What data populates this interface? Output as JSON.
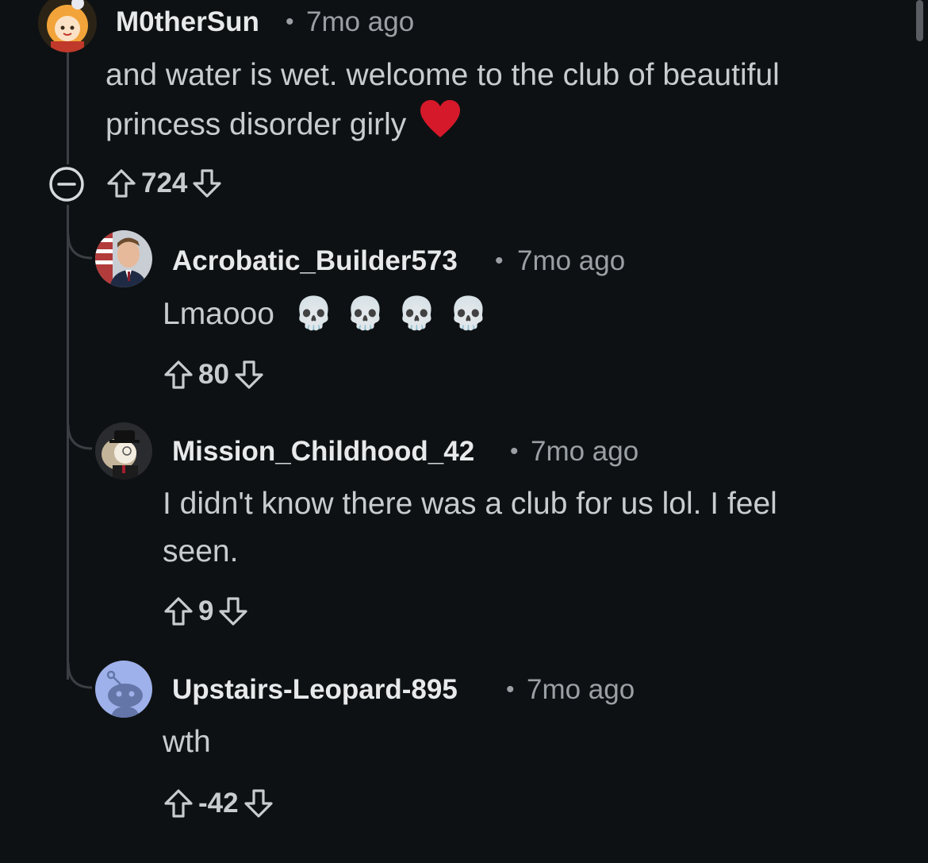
{
  "comments": [
    {
      "username": "M0therSun",
      "separator": "•",
      "time": "7mo ago",
      "body_lines": [
        "and water is wet. welcome to the club of beautiful",
        "princess disorder girly"
      ],
      "emoji": "❤️",
      "score": "724"
    },
    {
      "username": "Acrobatic_Builder573",
      "separator": "•",
      "time": "7mo ago",
      "body": "Lmaooo",
      "emoji": "💀 💀 💀 💀",
      "score": "80"
    },
    {
      "username": "Mission_Childhood_42",
      "separator": "•",
      "time": "7mo ago",
      "body_lines": [
        "I didn't know there was a club for us lol. I feel",
        "seen."
      ],
      "score": "9"
    },
    {
      "username": "Upstairs-Leopard-895",
      "separator": "•",
      "time": "7mo ago",
      "body": "wth",
      "score": "-42"
    }
  ],
  "icons": {
    "collapse": "minus-circle-icon",
    "upvote": "arrow-up-icon",
    "downvote": "arrow-down-icon"
  },
  "colors": {
    "background": "#0e1113",
    "text": "#c9ccce",
    "username": "#e7e9ea",
    "meta": "#9aa0a4",
    "thread_line": "#3a3f43",
    "heart": "#d6192a",
    "default_avatar_bg": "#9fb1ea"
  }
}
